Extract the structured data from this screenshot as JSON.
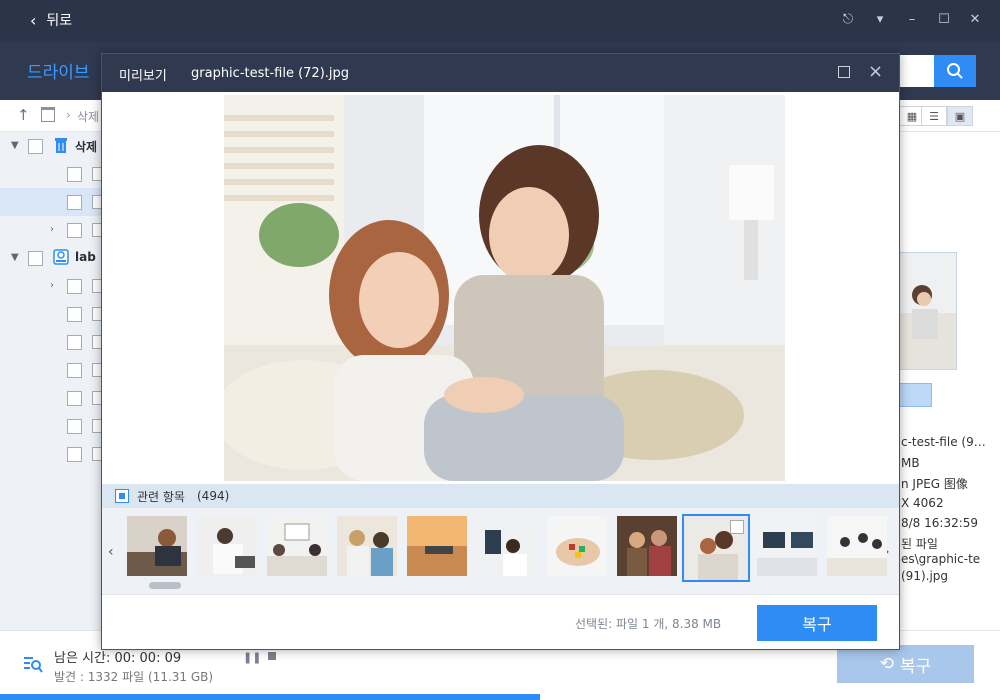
{
  "window": {
    "back_label": "뒤로"
  },
  "header": {
    "tab_label": "드라이브"
  },
  "toolbar": {
    "path_label": "삭제"
  },
  "tree": {
    "nodes": [
      {
        "label": "삭제",
        "icon": "trash-icon"
      },
      {
        "label": "lab",
        "icon": "drive-icon"
      }
    ]
  },
  "detail": {
    "lines": [
      "c-test-file (9…",
      "MB",
      "n JPEG 图像",
      "X 4062",
      "8/8 16:32:59",
      "된 파일",
      "es\\graphic-te",
      "(91).jpg"
    ]
  },
  "status": {
    "remaining": "남은 시간: 00: 00: 09",
    "found": "발견 : 1332 파일 (11.31 GB)",
    "restore_label": "복구",
    "progress": 0.54
  },
  "modal": {
    "title": "미리보기",
    "filename": "graphic-test-file (72).jpg",
    "related_label": "관련 항목",
    "related_count": "(494)",
    "selection_info": "선택된: 파일 1 개, 8.38 MB",
    "restore_label": "복구"
  },
  "colors": {
    "accent": "#2f8cf5",
    "titlebar": "#2b3549",
    "header": "#2f3a50"
  }
}
